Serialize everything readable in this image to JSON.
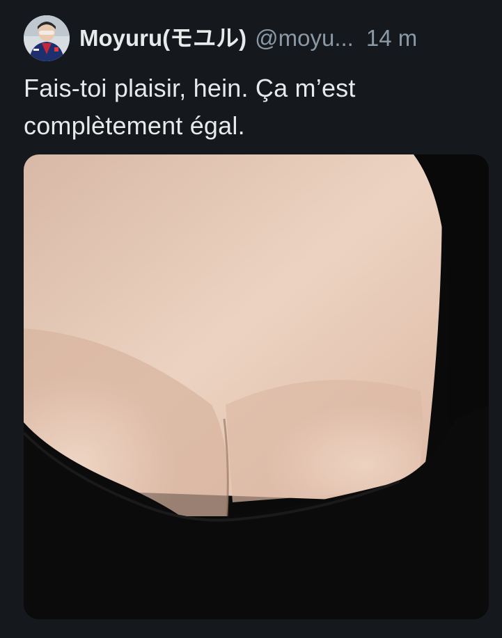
{
  "post": {
    "author": {
      "display_name": "Moyuru(モユル)",
      "handle": "@moyu...",
      "avatar_icon": "user-avatar-photo"
    },
    "timestamp": "14 m",
    "text": "Fais-toi plaisir, hein. Ça m’est complètement égal.",
    "media": {
      "type": "photo"
    }
  },
  "colors": {
    "background": "#15181c",
    "primary_text": "#e7e9ea",
    "secondary_text": "#8b98a5"
  }
}
